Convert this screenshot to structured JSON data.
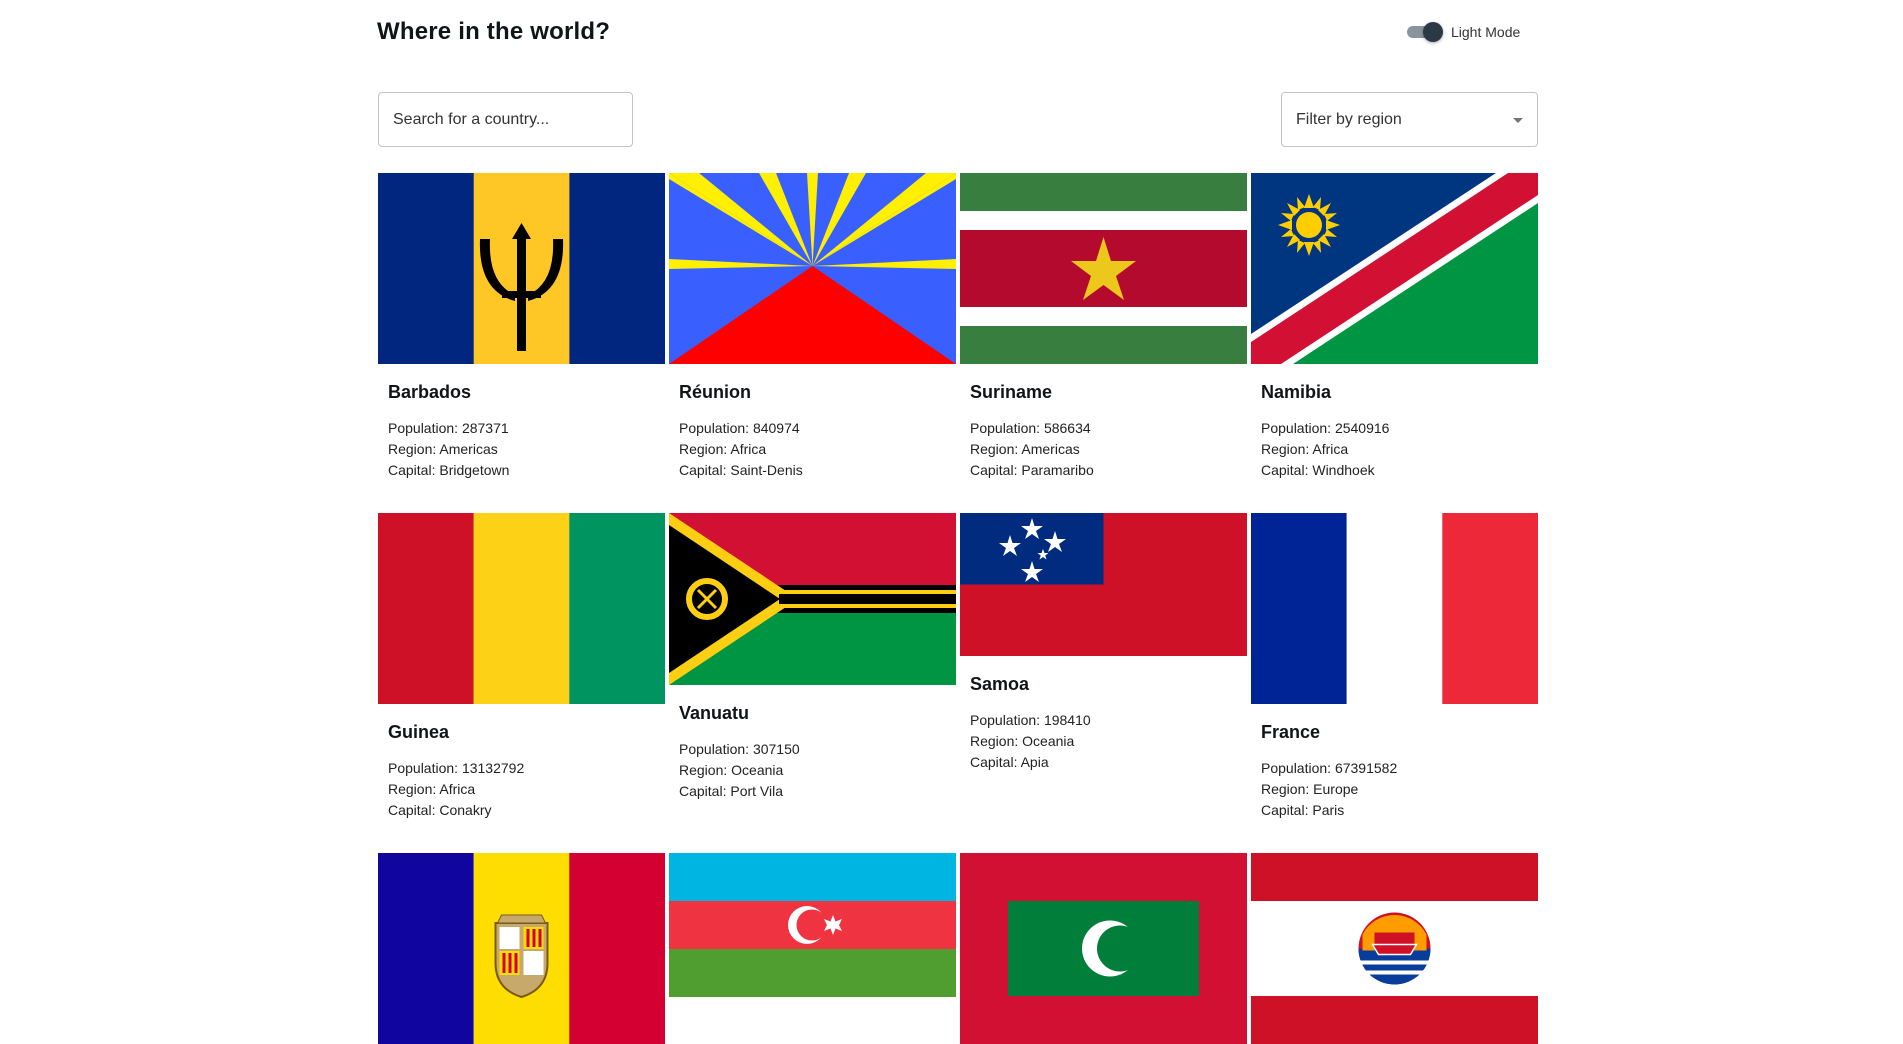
{
  "header": {
    "title": "Where in the world?",
    "mode_label": "Light Mode"
  },
  "search": {
    "placeholder": "Search for a country..."
  },
  "filter": {
    "label": "Filter by region"
  },
  "labels": {
    "population": "Population:",
    "region": "Region:",
    "capital": "Capital:"
  },
  "countries": [
    {
      "name": "Barbados",
      "population": "287371",
      "region": "Americas",
      "capital": "Bridgetown"
    },
    {
      "name": "Réunion",
      "population": "840974",
      "region": "Africa",
      "capital": "Saint-Denis"
    },
    {
      "name": "Suriname",
      "population": "586634",
      "region": "Americas",
      "capital": "Paramaribo"
    },
    {
      "name": "Namibia",
      "population": "2540916",
      "region": "Africa",
      "capital": "Windhoek"
    },
    {
      "name": "Guinea",
      "population": "13132792",
      "region": "Africa",
      "capital": "Conakry"
    },
    {
      "name": "Vanuatu",
      "population": "307150",
      "region": "Oceania",
      "capital": "Port Vila"
    },
    {
      "name": "Samoa",
      "population": "198410",
      "region": "Oceania",
      "capital": "Apia"
    },
    {
      "name": "France",
      "population": "67391582",
      "region": "Europe",
      "capital": "Paris"
    }
  ],
  "colors": {
    "toggle_thumb": "#2b3945",
    "toggle_track": "#8a949e",
    "text": "#111517",
    "border": "#c4c4c4"
  }
}
